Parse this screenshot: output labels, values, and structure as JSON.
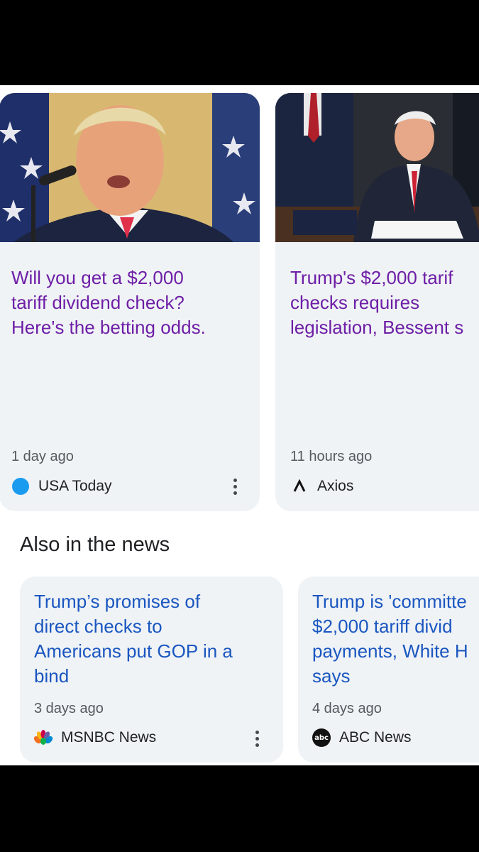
{
  "top_stories": [
    {
      "title_lines": [
        "Will you get a $2,000",
        "tariff dividend check?",
        "Here's the betting odds."
      ],
      "time": "1 day ago",
      "source": "USA Today",
      "source_icon": "usa-today-logo",
      "has_menu": true
    },
    {
      "title_lines": [
        "Trump's $2,000 tarif",
        "checks requires",
        "legislation, Bessent s"
      ],
      "time": "11 hours ago",
      "source": "Axios",
      "source_icon": "axios-logo",
      "has_menu": false
    }
  ],
  "also_in_news": {
    "heading": "Also in the news",
    "items": [
      {
        "title_lines": [
          "Trump’s promises of",
          "direct checks to",
          "Americans put GOP in a",
          "bind"
        ],
        "time": "3 days ago",
        "source": "MSNBC News",
        "source_icon": "msnbc-peacock-logo",
        "has_menu": true
      },
      {
        "title_lines": [
          "Trump is 'committe",
          "$2,000 tariff divid",
          "payments, White H",
          "says"
        ],
        "time": "4 days ago",
        "source": "ABC News",
        "source_icon": "abc-news-logo",
        "logo_text": "abc",
        "has_menu": false
      }
    ]
  },
  "colors": {
    "visited_title": "#6e1ea6",
    "link_title": "#1a56c0",
    "card_bg": "#eff3f6",
    "usa_today_blue": "#1a9bf0"
  }
}
